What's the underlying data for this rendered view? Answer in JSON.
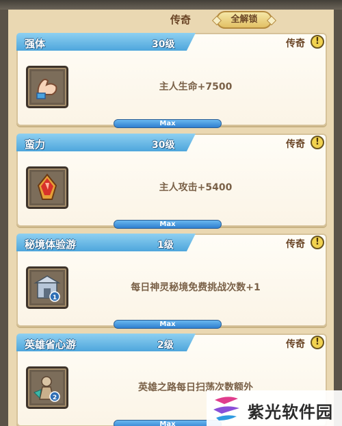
{
  "header": {
    "title": "传奇",
    "unlock_all_label": "全解锁"
  },
  "cards": [
    {
      "name": "强体",
      "level": "30级",
      "rarity": "传奇",
      "info": "!",
      "description": "主人生命+7500",
      "progress_label": "Max",
      "progress": 1.0,
      "icon": "muscle-arm-icon"
    },
    {
      "name": "蛮力",
      "level": "30级",
      "rarity": "传奇",
      "info": "!",
      "description": "主人攻击+5400",
      "progress_label": "Max",
      "progress": 1.0,
      "icon": "red-flame-crystal-icon"
    },
    {
      "name": "秘境体验游",
      "level": "1级",
      "rarity": "传奇",
      "info": "!",
      "description": "每日神灵秘境免费挑战次数+1",
      "progress_label": "Max",
      "progress": 1.0,
      "icon": "temple-gate-icon"
    },
    {
      "name": "英雄省心游",
      "level": "2级",
      "rarity": "传奇",
      "info": "!",
      "description": "英雄之路每日扫荡次数额外",
      "progress_label": "Max",
      "progress": 1.0,
      "icon": "hero-flag-icon"
    }
  ],
  "watermark": {
    "text": "紫光软件园",
    "icon": "zg-logo-icon"
  },
  "colors": {
    "ribbon": "#4ea6dc",
    "bar": "#2f7fcf",
    "panel": "#ead8b2"
  }
}
